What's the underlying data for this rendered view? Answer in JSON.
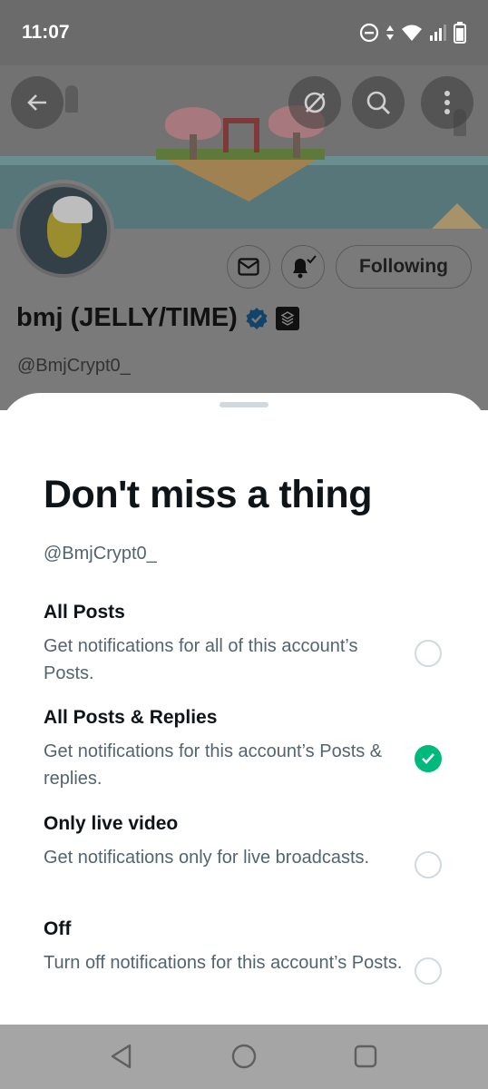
{
  "status_bar": {
    "time": "11:07",
    "icons": [
      "do-not-disturb-icon",
      "data-arrows-icon",
      "wifi-icon",
      "signal-icon",
      "battery-icon"
    ]
  },
  "profile": {
    "display_name": "bmj (JELLY/TIME)",
    "handle": "@BmjCrypt0_",
    "following_label": "Following",
    "verified_color": "#1d9bf0",
    "header_buttons": [
      "back-arrow-icon",
      "grok-icon",
      "search-icon",
      "more-vertical-icon"
    ],
    "action_buttons": [
      "mail-icon",
      "bell-check-icon"
    ]
  },
  "sheet": {
    "title": "Don't miss a thing",
    "handle": "@BmjCrypt0_",
    "options": [
      {
        "title": "All Posts",
        "desc": "Get notifications for all of this account’s Posts.",
        "selected": false
      },
      {
        "title": "All Posts & Replies",
        "desc": "Get notifications for this account’s Posts & replies.",
        "selected": true
      },
      {
        "title": "Only live video",
        "desc": "Get notifications only for live broadcasts.",
        "selected": false
      },
      {
        "title": "Off",
        "desc": "Turn off notifications for this account’s Posts.",
        "selected": false
      }
    ],
    "selected_color": "#00ba7c"
  },
  "nav_bar": {
    "buttons": [
      "back-triangle-icon",
      "home-circle-icon",
      "recents-square-icon"
    ]
  }
}
